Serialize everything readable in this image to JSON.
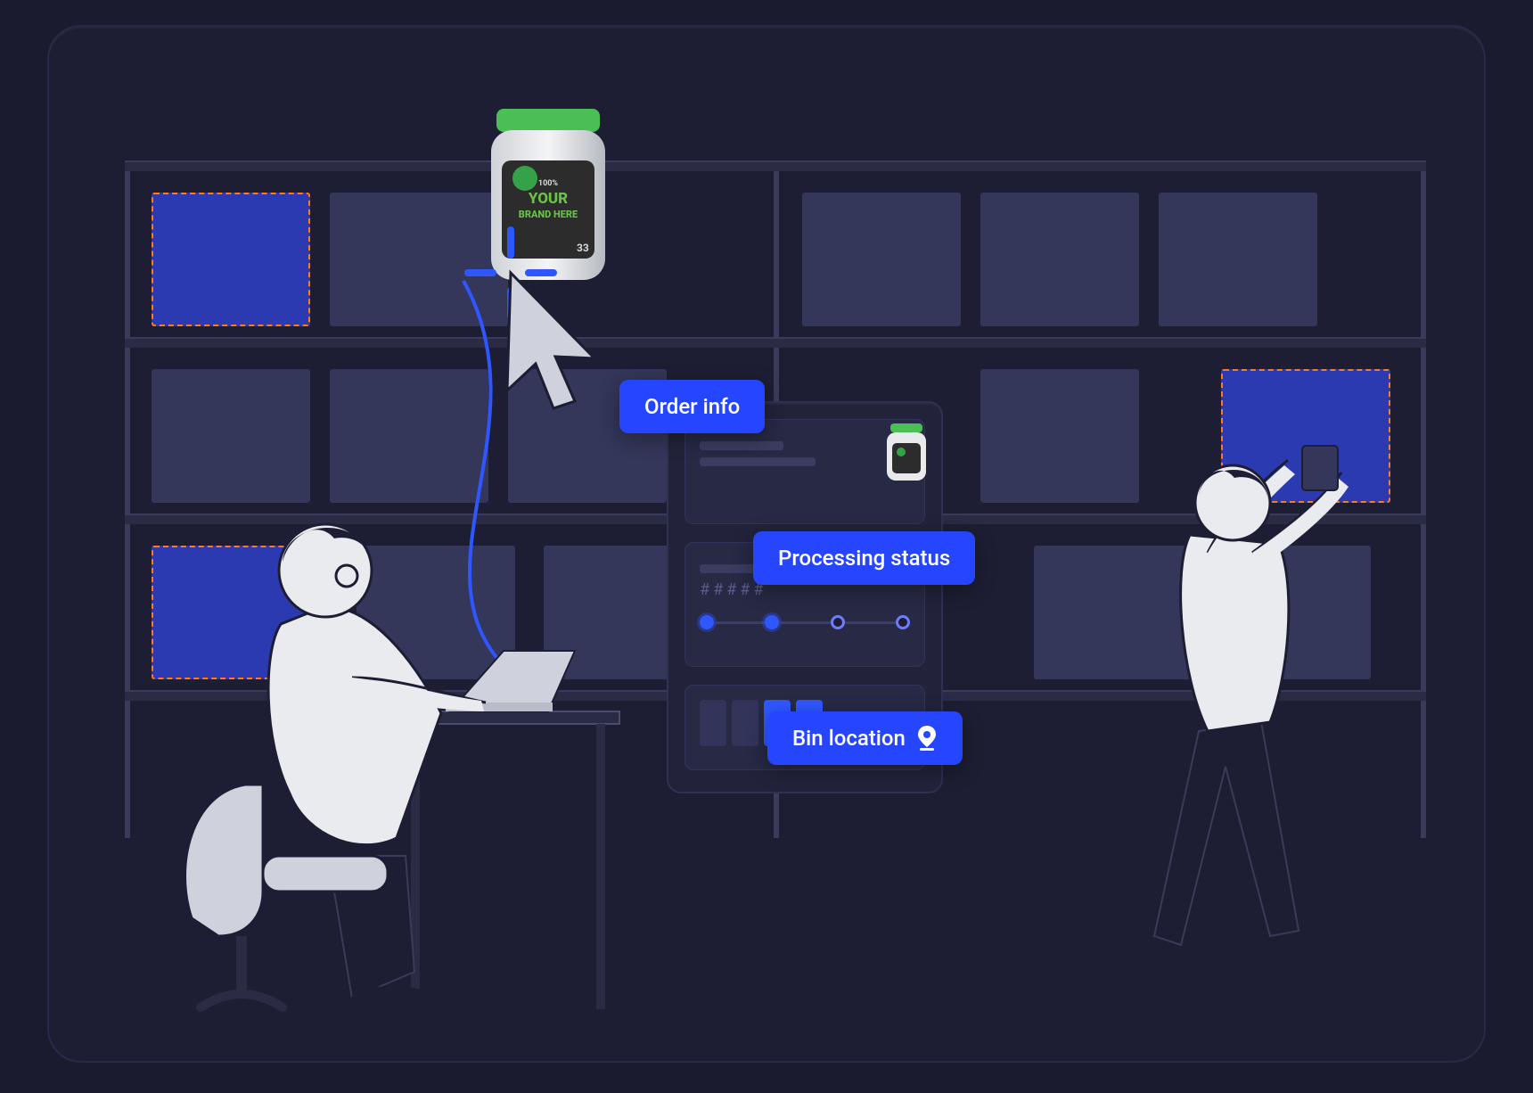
{
  "callouts": {
    "order_info": "Order info",
    "processing_status": "Processing status",
    "bin_location": "Bin location"
  },
  "dashboard": {
    "hash_placeholder": "#####"
  },
  "product": {
    "label_top": "100%",
    "label_brand1": "YOUR",
    "label_brand2": "BRAND HERE",
    "servings": "33"
  },
  "colors": {
    "accent": "#2545ff",
    "highlight_dash": "#ff7a1a"
  }
}
